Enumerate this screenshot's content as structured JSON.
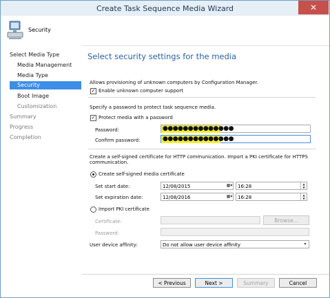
{
  "window": {
    "title": "Create Task Sequence Media Wizard",
    "close_glyph": "✕"
  },
  "header": {
    "page_label": "Security",
    "icon": "computer-icon"
  },
  "nav": {
    "items": [
      {
        "label": "Select Media Type"
      },
      {
        "label": "Media Management"
      },
      {
        "label": "Media Type"
      },
      {
        "label": "Security"
      },
      {
        "label": "Boot Image"
      },
      {
        "label": "Customization"
      },
      {
        "label": "Summary"
      },
      {
        "label": "Progress"
      },
      {
        "label": "Completion"
      }
    ]
  },
  "content": {
    "heading": "Select security settings for the media",
    "unknown": {
      "description": "Allows provisioning of unknown computers by Configuration Manager.",
      "enable_label": "Enable unknown computer support",
      "checked": true
    },
    "password": {
      "description": "Specify a password to protect task sequence media.",
      "protect_label": "Protect media with a password",
      "checked": true,
      "password_label": "Password:",
      "password_value": "●●●●●●●●●●●●●●",
      "confirm_label": "Confirm password:",
      "confirm_value": "●●●●●●●●●●●●●●"
    },
    "certificate": {
      "description_line1": "Create a self-signed certificate for HTTP communication. Import a PKI certificate for HTTPS",
      "description_line2": "communication.",
      "self_signed_label": "Create self-signed media certificate",
      "start_label": "Set start date:",
      "start_date": "12/08/2015",
      "start_time": "16:28",
      "expiration_label": "Set expiration date:",
      "expiration_date": "12/08/2016",
      "expiration_time": "16:28",
      "pki_label": "Import PKI certificate",
      "cert_label": "Certificate:",
      "cert_password_label": "Password:",
      "browse_label": "Browse..."
    },
    "affinity": {
      "label": "User device affinity:",
      "value": "Do not allow user device affinity"
    }
  },
  "footer": {
    "previous": "< Previous",
    "next": "Next >",
    "summary": "Summary",
    "cancel": "Cancel"
  },
  "colors": {
    "accent": "#3d8ee6",
    "heading": "#2b62a5",
    "highlight": "#f3ee35"
  }
}
